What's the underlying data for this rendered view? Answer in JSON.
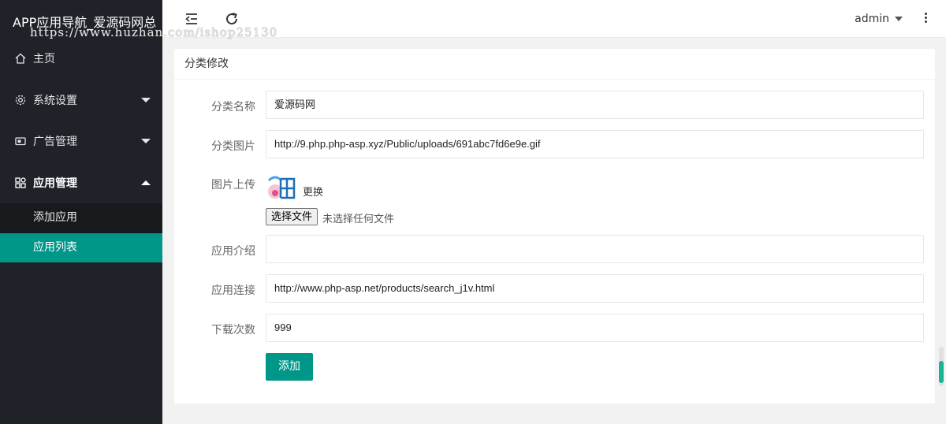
{
  "app": {
    "title": "APP应用导航_爱源码网总",
    "watermark": "https://www.huzhan.com/ishop25130"
  },
  "sidebar": {
    "items": [
      {
        "label": "主页",
        "icon": "home-icon"
      },
      {
        "label": "系统设置",
        "icon": "gear-icon"
      },
      {
        "label": "广告管理",
        "icon": "ad-icon"
      },
      {
        "label": "应用管理",
        "icon": "apps-icon"
      }
    ],
    "submenu": [
      {
        "label": "添加应用"
      },
      {
        "label": "应用列表"
      }
    ]
  },
  "header": {
    "user": "admin"
  },
  "form": {
    "title": "分类修改",
    "fields": {
      "name_label": "分类名称",
      "name_value": "爱源码网",
      "image_label": "分类图片",
      "image_value": "http://9.php.php-asp.xyz/Public/uploads/691abc7fd6e9e.gif",
      "upload_label": "图片上传",
      "change_label": "更换",
      "file_button": "选择文件",
      "file_status": "未选择任何文件",
      "intro_label": "应用介绍",
      "intro_value": "",
      "link_label": "应用连接",
      "link_value": "http://www.php-asp.net/products/search_j1v.html",
      "downloads_label": "下载次数",
      "downloads_value": "999"
    },
    "submit_label": "添加"
  },
  "colors": {
    "sidebar_bg": "#20222a",
    "accent": "#009688"
  }
}
